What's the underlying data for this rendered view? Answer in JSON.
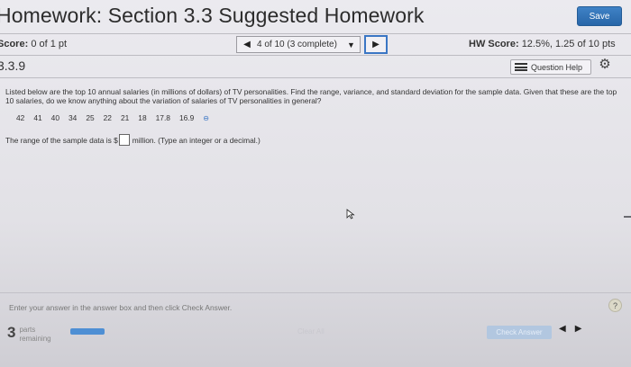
{
  "header": {
    "title": "Homework: Section 3.3 Suggested Homework",
    "save_label": "Save"
  },
  "score_row": {
    "score_label": "Score:",
    "score_value": "0 of 1 pt",
    "nav_prev_icon": "triangle-left-icon",
    "question_count": "4 of 10 (3 complete)",
    "nav_next_icon": "triangle-right-icon",
    "hw_score_label": "HW Score:",
    "hw_score_value": "12.5%, 1.25 of 10 pts"
  },
  "question_bar": {
    "number": "3.3.9",
    "help_label": "Question Help",
    "settings_icon": "gear-icon"
  },
  "question": {
    "text": "Listed below are the top 10 annual salaries (in millions of dollars) of TV personalities. Find the range, variance, and standard deviation for the sample data. Given that these are the top 10 salaries, do we know anything about the variation of salaries of TV personalities in general?",
    "values": [
      "42",
      "41",
      "40",
      "34",
      "25",
      "22",
      "21",
      "18",
      "17.8",
      "16.9"
    ],
    "answer_prefix": "The range of the sample data is $",
    "answer_suffix": "million. (Type an integer or a decimal.)",
    "answer_value": ""
  },
  "footer": {
    "hint": "Enter your answer in the answer box and then click Check Answer.",
    "parts_count": "3",
    "parts_label_1": "parts",
    "parts_label_2": "remaining",
    "progress_fraction": 1.0,
    "clear_all_label": "Clear All",
    "check_answer_label": "Check Answer",
    "help_glyph": "?"
  },
  "colors": {
    "accent": "#3a76c4",
    "save_button": "#2f6fb3",
    "check_button_disabled": "#b2c7e0"
  }
}
